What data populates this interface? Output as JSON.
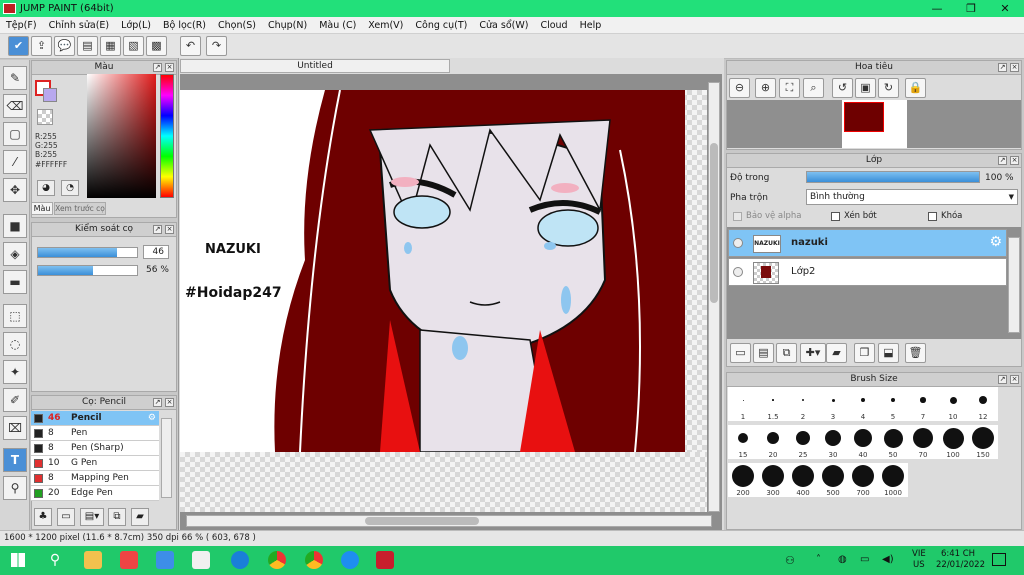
{
  "window": {
    "title": "JUMP PAINT (64bit)",
    "controls": [
      "—",
      "❐",
      "✕"
    ]
  },
  "menu": [
    "Tệp(F)",
    "Chỉnh sửa(E)",
    "Lớp(L)",
    "Bộ lọc(R)",
    "Chọn(S)",
    "Chụp(N)",
    "Màu (C)",
    "Xem(V)",
    "Công cụ(T)",
    "Cửa sổ(W)",
    "Cloud",
    "Help"
  ],
  "color_panel": {
    "title": "Màu",
    "r": "R:255",
    "g": "G:255",
    "b": "B:255",
    "hex": "#FFFFFF",
    "tab_color": "Màu",
    "tab_preview": "Xem trước cọ"
  },
  "brush_control": {
    "title": "Kiểm soát cọ",
    "size": "46",
    "size_fraction": 0.8,
    "opacity": "56 %",
    "opacity_fraction": 0.56
  },
  "brush_panel": {
    "title": "Cọ: Pencil",
    "items": [
      {
        "size": "46",
        "name": "Pencil",
        "color": "#222222"
      },
      {
        "size": "8",
        "name": "Pen",
        "color": "#222222"
      },
      {
        "size": "8",
        "name": "Pen (Sharp)",
        "color": "#222222"
      },
      {
        "size": "10",
        "name": "G Pen",
        "color": "#e03030"
      },
      {
        "size": "8",
        "name": "Mapping Pen",
        "color": "#e03030"
      },
      {
        "size": "20",
        "name": "Edge Pen",
        "color": "#22a022"
      }
    ]
  },
  "canvas": {
    "tab": "Untitled",
    "text1": "NAZUKI",
    "text2": "#Hoidap247"
  },
  "navigator": {
    "title": "Hoa tiêu"
  },
  "layer_panel": {
    "title": "Lớp",
    "opacity_label": "Độ trong",
    "opacity_value": "100 %",
    "opacity_fraction": 1.0,
    "blend_label": "Pha trộn",
    "blend_value": "Bình thường",
    "protect_alpha": "Bảo vệ alpha",
    "clipping": "Xén bớt",
    "lock": "Khóa",
    "layers": [
      {
        "name": "nazuki",
        "thumb": "NAZUKI"
      },
      {
        "name": "Lớp2",
        "thumb": ""
      }
    ]
  },
  "brush_size": {
    "title": "Brush Size",
    "sizes": [
      "1",
      "1.5",
      "2",
      "3",
      "4",
      "5",
      "7",
      "10",
      "12",
      "15",
      "20",
      "25",
      "30",
      "40",
      "50",
      "70",
      "100",
      "150",
      "200",
      "300",
      "400",
      "500",
      "700",
      "1000"
    ]
  },
  "status": {
    "text": "1600 * 1200 pixel  (11.6 * 8.7cm)  350 dpi  66 %  ( 603, 678 )"
  },
  "taskbar": {
    "lang1": "VIE",
    "lang2": "US",
    "time": "6:41 CH",
    "date": "22/01/2022"
  }
}
